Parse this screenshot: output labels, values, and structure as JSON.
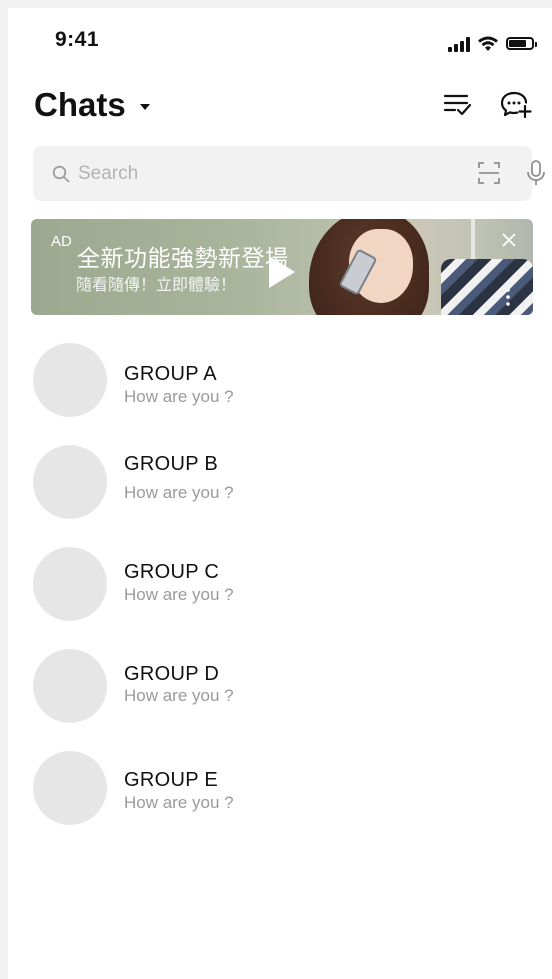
{
  "status_bar": {
    "time": "9:41",
    "battery_level": 0.85
  },
  "header": {
    "title": "Chats",
    "icons": [
      "caret-down-icon",
      "sort-list-icon",
      "new-chat-icon"
    ]
  },
  "search": {
    "placeholder": "Search",
    "value": "",
    "icons": [
      "search-icon",
      "scan-icon",
      "microphone-icon"
    ]
  },
  "ad": {
    "tag": "AD",
    "headline": "全新功能強勢新登場",
    "subline": "隨看隨傳！立即體驗！",
    "icons": [
      "play-icon",
      "close-icon",
      "more-icon"
    ]
  },
  "chats": [
    {
      "name": "GROUP A",
      "preview": "How are you ?"
    },
    {
      "name": "GROUP B",
      "preview": "How are you ?"
    },
    {
      "name": "GROUP C",
      "preview": "How are you ?"
    },
    {
      "name": "GROUP D",
      "preview": "How are you ?"
    },
    {
      "name": "GROUP E",
      "preview": "How are you ?"
    }
  ],
  "colors": {
    "text_primary": "#111111",
    "text_secondary": "#9a9a9a",
    "search_bg": "#f2f2f2",
    "avatar_placeholder": "#e6e6e6"
  }
}
